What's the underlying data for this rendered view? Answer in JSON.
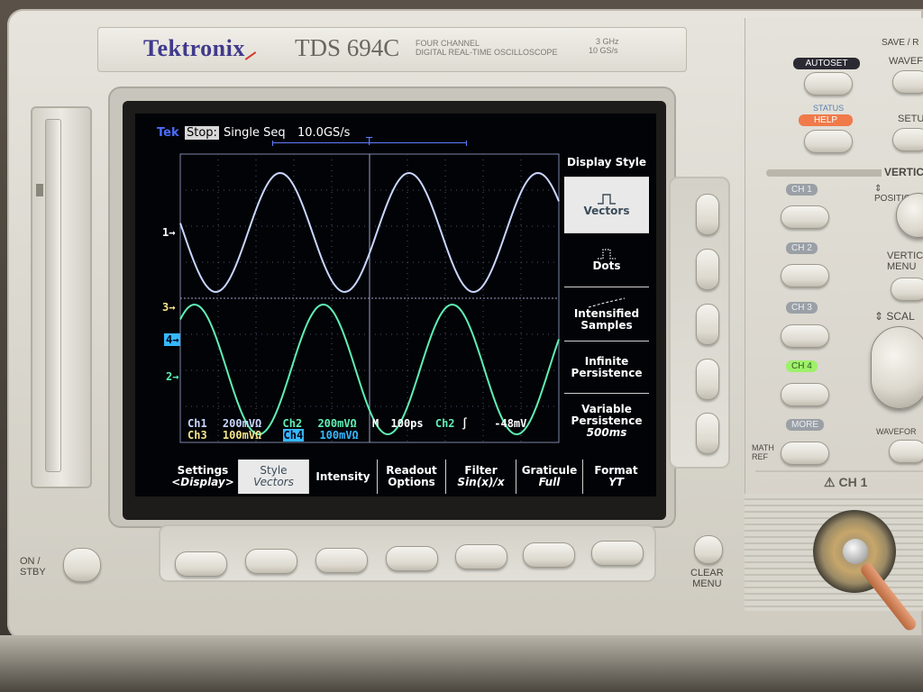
{
  "nameplate": {
    "brand": "Tektronix",
    "model": "TDS 694C",
    "desc_line1": "FOUR CHANNEL",
    "desc_line2": "DIGITAL REAL-TIME OSCILLOSCOPE",
    "spec_line1": "3 GHz",
    "spec_line2": "10 GS/s"
  },
  "screen": {
    "tek_label": "Tek",
    "state_label": "Stop:",
    "acq_mode": "Single Seq",
    "sample_rate": "10.0GS/s",
    "trigger_marker": "T",
    "markers": {
      "ch1": "1",
      "ch3": "3",
      "ch4": "4",
      "ch2": "2"
    },
    "side_menu": {
      "title": "Display Style",
      "items": [
        {
          "line1": "Vectors",
          "line2": ""
        },
        {
          "line1": "Dots",
          "line2": ""
        },
        {
          "line1": "Intensified",
          "line2": "Samples"
        },
        {
          "line1": "Infinite",
          "line2": "Persistence"
        },
        {
          "line1": "Variable",
          "line2": "Persistence",
          "line3": "500ms"
        }
      ]
    },
    "readout": {
      "ch1": "Ch1",
      "ch1_scale": "200mVΩ",
      "ch2": "Ch2",
      "ch2_scale": "200mVΩ",
      "ch3": "Ch3",
      "ch3_scale": "100mVΩ",
      "ch4": "Ch4",
      "ch4_scale": "100mVΩ",
      "timebase_prefix": "M",
      "timebase": "100ps",
      "trigger_src": "Ch2",
      "trigger_slope": "∫",
      "trigger_level": "-48mV"
    },
    "bottom_menu": [
      {
        "line1": "Settings",
        "line2": "<Display>"
      },
      {
        "line1": "Style",
        "line2": "Vectors"
      },
      {
        "line1": "Intensity",
        "line2": ""
      },
      {
        "line1": "Readout",
        "line2": "Options"
      },
      {
        "line1": "Filter",
        "line2": "Sin(x)/x"
      },
      {
        "line1": "Graticule",
        "line2": "Full"
      },
      {
        "line1": "Format",
        "line2": "YT"
      }
    ]
  },
  "panel": {
    "autoset": "AUTOSET",
    "status": "STATUS",
    "help": "HELP",
    "save_recall": "SAVE / R",
    "wave": "WAVEF",
    "setup": "SETU",
    "vertical": "VERTIC",
    "position": "POSITION",
    "ch1": "CH 1",
    "ch2": "CH 2",
    "ch3": "CH 3",
    "ch4": "CH 4",
    "more": "MORE",
    "math_ref_line1": "MATH",
    "math_ref_line2": "REF",
    "vertical_menu_line1": "VERTIC",
    "vertical_menu_line2": "MENU",
    "scale": "SCAL",
    "waveform": "WAVEFOR",
    "ch1_connector": "CH 1",
    "on_stby_line1": "ON /",
    "on_stby_line2": "STBY",
    "clear_menu_line1": "CLEAR",
    "clear_menu_line2": "MENU"
  },
  "colors": {
    "trace_ch1": "#c9d6ff",
    "trace_ch2": "#5ff0b5",
    "ch3_marker": "#f4e48a",
    "ch4_marker": "#35b8ff",
    "help_badge": "#f07a4a",
    "ch4_badge": "#9ef06a"
  }
}
